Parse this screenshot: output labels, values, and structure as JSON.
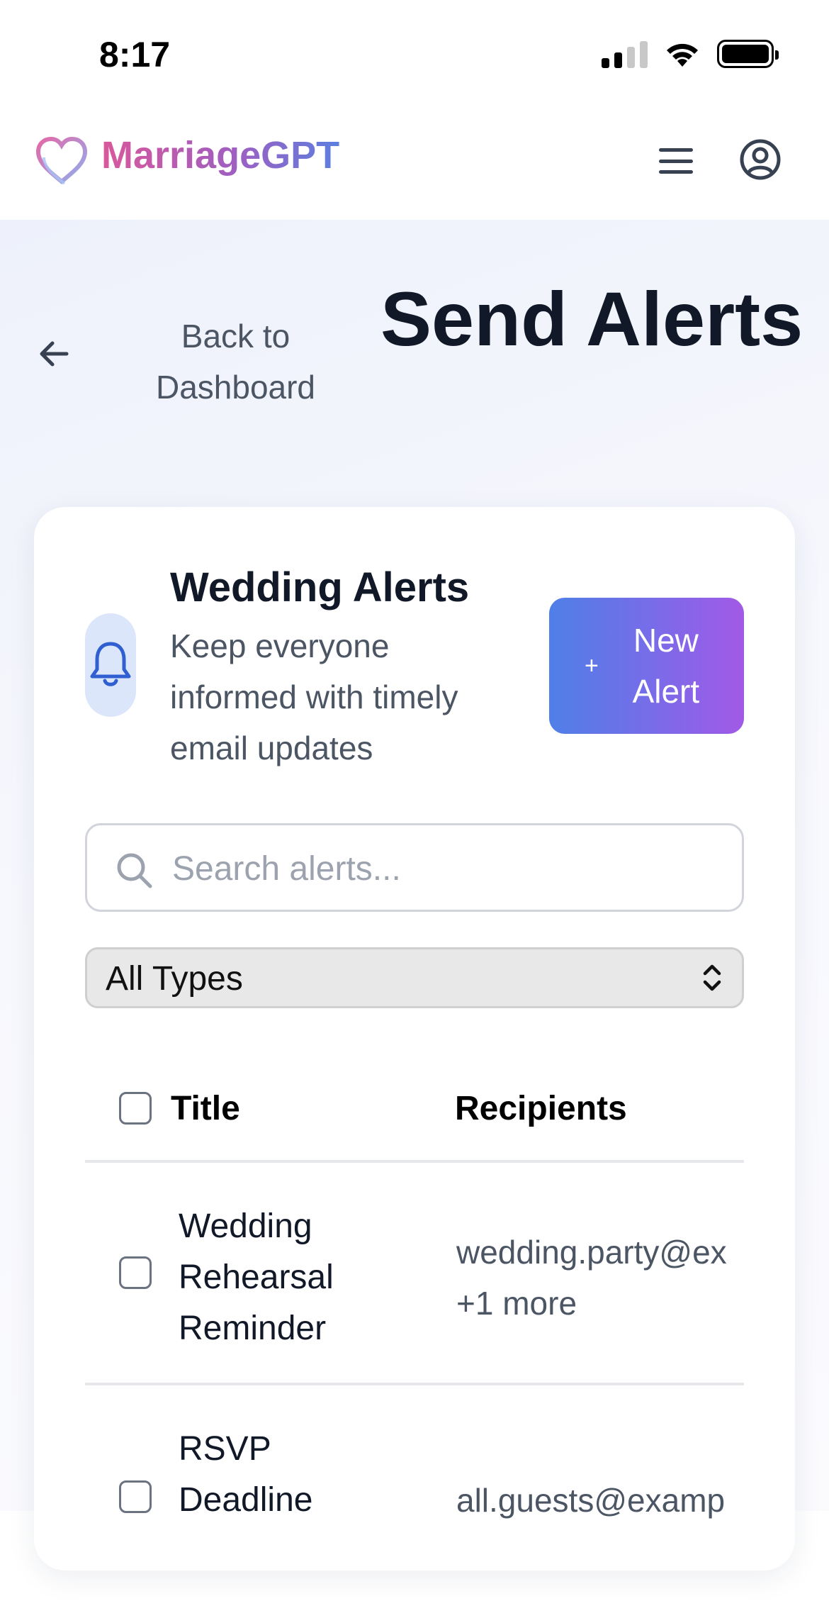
{
  "status_bar": {
    "time": "8:17"
  },
  "header": {
    "brand": "MarriageGPT"
  },
  "nav": {
    "back_label": "Back to Dashboard",
    "page_title": "Send Alerts"
  },
  "alerts_section": {
    "title": "Wedding Alerts",
    "subtitle": "Keep everyone informed with timely email updates",
    "new_alert_icon": "+",
    "new_alert_label": "New Alert"
  },
  "search": {
    "placeholder": "Search alerts...",
    "value": ""
  },
  "filter": {
    "selected": "All Types"
  },
  "table": {
    "columns": [
      "Title",
      "Recipients"
    ],
    "rows": [
      {
        "title": "Wedding Rehearsal Reminder",
        "recipients": "wedding.party@ex",
        "more": "+1 more"
      },
      {
        "title": "RSVP Deadline",
        "recipients": "all.guests@examp",
        "more": ""
      }
    ]
  },
  "colors": {
    "accent_start": "#4f7fe8",
    "accent_end": "#a25ae6",
    "brand_pink": "#d9589b",
    "brand_blue": "#5b7fe0",
    "text_dark": "#111827",
    "text_muted": "#4b5563"
  },
  "icons": {
    "logo": "heart-icon",
    "menu": "hamburger-icon",
    "account": "user-circle-icon",
    "back": "arrow-left-icon",
    "section": "bell-icon",
    "search": "search-icon",
    "select": "chevron-up-down-icon"
  }
}
